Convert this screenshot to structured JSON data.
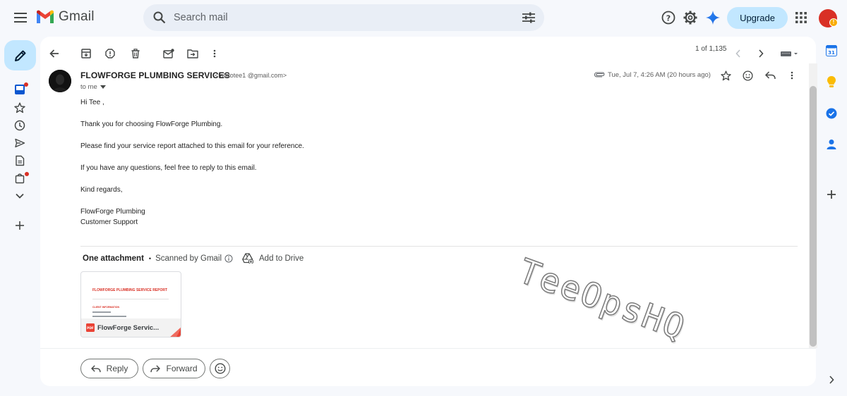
{
  "app": {
    "name": "Gmail"
  },
  "search": {
    "placeholder": "Search mail"
  },
  "header": {
    "upgrade_label": "Upgrade"
  },
  "toolbar": {
    "pager": "1 of 1,135"
  },
  "message": {
    "sender_name": "FLOWFORGE PLUMBING SERVICES",
    "sender_email": "<talktotee1     @gmail.com>",
    "to_label": "to me",
    "date": "Tue, Jul 7, 4:26 AM (20 hours ago)",
    "greeting": "Hi Tee ,",
    "line1": "Thank you for choosing FlowForge Plumbing.",
    "line2": "Please find your service report attached to this email for your reference.",
    "line3": "If you have any questions, feel free to reply to this email.",
    "closing": "Kind regards,",
    "signature_name": "FlowForge Plumbing",
    "signature_team": "Customer Support"
  },
  "attachments": {
    "title": "One attachment",
    "separator": "•",
    "scanned_label": "Scanned by Gmail",
    "add_to_drive_label": "Add to Drive",
    "file": {
      "name": "FlowForge Servic...",
      "type_badge": "PDF",
      "preview_title": "FLOWFORGE PLUMBING SERVICE REPORT",
      "preview_section": "CLIENT INFORMATION"
    }
  },
  "actions": {
    "reply_label": "Reply",
    "forward_label": "Forward"
  },
  "watermark": "TeeOpsHQ",
  "side_panel": {
    "calendar_day": "31"
  },
  "colors": {
    "accent": "#c2e7ff",
    "background": "#f6f8fc",
    "danger": "#d93025",
    "brand_red": "#ea4335"
  },
  "icons": {
    "topbar": [
      "menu-icon",
      "gmail-logo",
      "search-icon",
      "search-options-icon",
      "help-icon",
      "settings-icon",
      "gemini-icon",
      "apps-icon"
    ],
    "toolbar": [
      "back-icon",
      "archive-icon",
      "report-spam-icon",
      "delete-icon",
      "mark-unread-icon",
      "move-to-icon",
      "more-icon",
      "prev-icon",
      "next-icon",
      "keyboard-icon"
    ]
  }
}
